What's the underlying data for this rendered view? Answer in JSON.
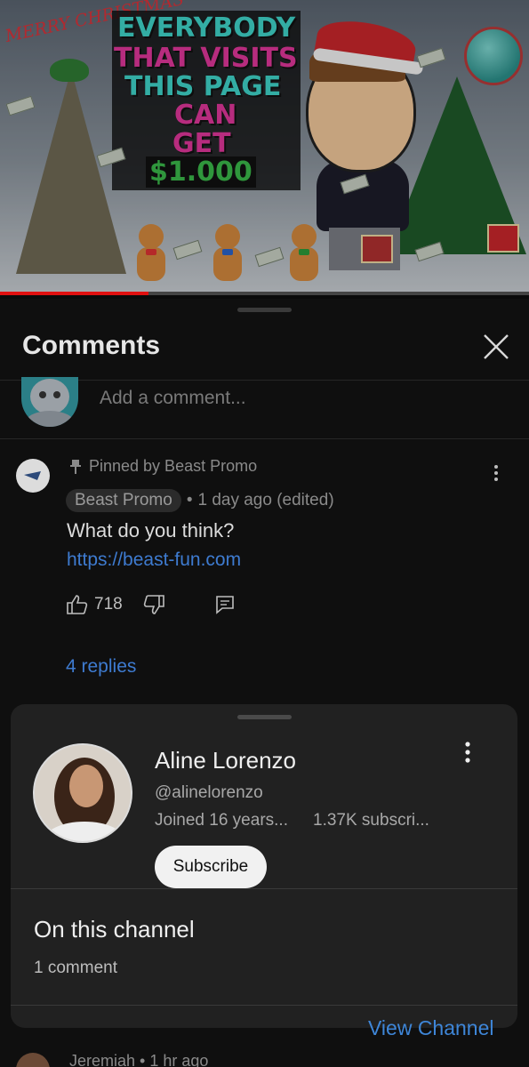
{
  "thumbnail": {
    "greeting": "MERRY CHRISTMAS",
    "headline_lines": [
      "EVERYBODY",
      "THAT VISITS",
      "THIS PAGE",
      "CAN",
      "GET",
      "$1.000"
    ]
  },
  "comments_panel": {
    "title": "Comments",
    "add_comment_placeholder": "Add a comment...",
    "pinned_label": "Pinned by Beast Promo",
    "author": "Beast Promo",
    "timestamp": "1 day ago (edited)",
    "text": "What do you think?",
    "link": "https://beast-fun.com",
    "like_count": "718",
    "replies_label": "4 replies",
    "next_author": "Jeremiah",
    "next_timestamp": "1 hr ago"
  },
  "channel_sheet": {
    "name": "Aline Lorenzo",
    "handle": "@alinelorenzo",
    "joined": "Joined 16 years...",
    "subscribers": "1.37K subscri...",
    "subscribe_label": "Subscribe",
    "section_title": "On this channel",
    "comment_count": "1 comment",
    "view_channel_label": "View Channel"
  },
  "colors": {
    "link_blue": "#3e7bd0",
    "progress_red": "#e01010",
    "panel_bg": "#0f0f0f",
    "sheet_bg": "#212121"
  }
}
